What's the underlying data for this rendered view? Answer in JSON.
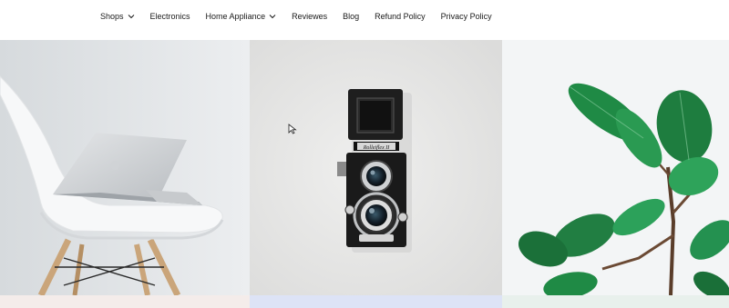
{
  "nav": {
    "items": [
      {
        "label": "Shops",
        "dropdown": true
      },
      {
        "label": "Electronics",
        "dropdown": false
      },
      {
        "label": "Home Appliance",
        "dropdown": true
      },
      {
        "label": "Reviewes",
        "dropdown": false
      },
      {
        "label": "Blog",
        "dropdown": false
      },
      {
        "label": "Refund Policy",
        "dropdown": false
      },
      {
        "label": "Privacy Policy",
        "dropdown": false
      }
    ]
  },
  "gallery": {
    "images": [
      {
        "subject": "laptop-on-chair"
      },
      {
        "subject": "vintage-camera"
      },
      {
        "subject": "green-plant"
      }
    ]
  },
  "camera": {
    "brand": "Rolleiflex II"
  },
  "colors": {
    "text": "#1a1a1a",
    "strip_pink": "#f4ecea",
    "strip_blue": "#dde3f6",
    "strip_green": "#e8f0ec",
    "leaf": "#1f8a45"
  }
}
